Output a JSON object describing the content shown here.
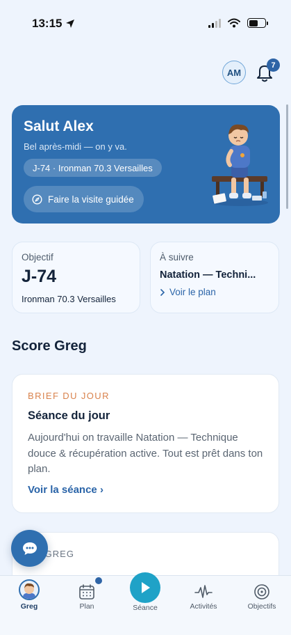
{
  "status": {
    "time": "13:15"
  },
  "header": {
    "initials": "AM",
    "notification_count": "7"
  },
  "hero": {
    "title": "Salut Alex",
    "subtitle": "Bel après-midi — on y va.",
    "pill": "J-74 · Ironman 70.3 Versailles",
    "tour_button": "Faire la visite guidée"
  },
  "goal": {
    "label": "Objectif",
    "value": "J-74",
    "race": "Ironman 70.3 Versailles"
  },
  "next": {
    "label": "À suivre",
    "session": "Natation — Techni...",
    "link": "Voir le plan"
  },
  "section_title": "Score Greg",
  "brief": {
    "label": "BRIEF DU JOUR",
    "title": "Séance du jour",
    "body": "Aujourd'hui on travaille Natation — Technique douce & récupération active. Tout est prêt dans ton plan.",
    "link": "Voir la séance ›"
  },
  "score_card": {
    "label": "RE GREG"
  },
  "tabs": [
    {
      "label": "Greg",
      "icon": "greg-avatar-icon",
      "active": true
    },
    {
      "label": "Plan",
      "icon": "calendar-icon"
    },
    {
      "label": "Séance",
      "icon": "play-icon"
    },
    {
      "label": "Activités",
      "icon": "activity-pulse-icon"
    },
    {
      "label": "Objectifs",
      "icon": "target-icon"
    }
  ],
  "colors": {
    "background": "#eef4fd",
    "hero": "#2f6fb0",
    "accent_link": "#2a64a8",
    "brief_label": "#d9824c",
    "play_button": "#1fa2c7"
  }
}
